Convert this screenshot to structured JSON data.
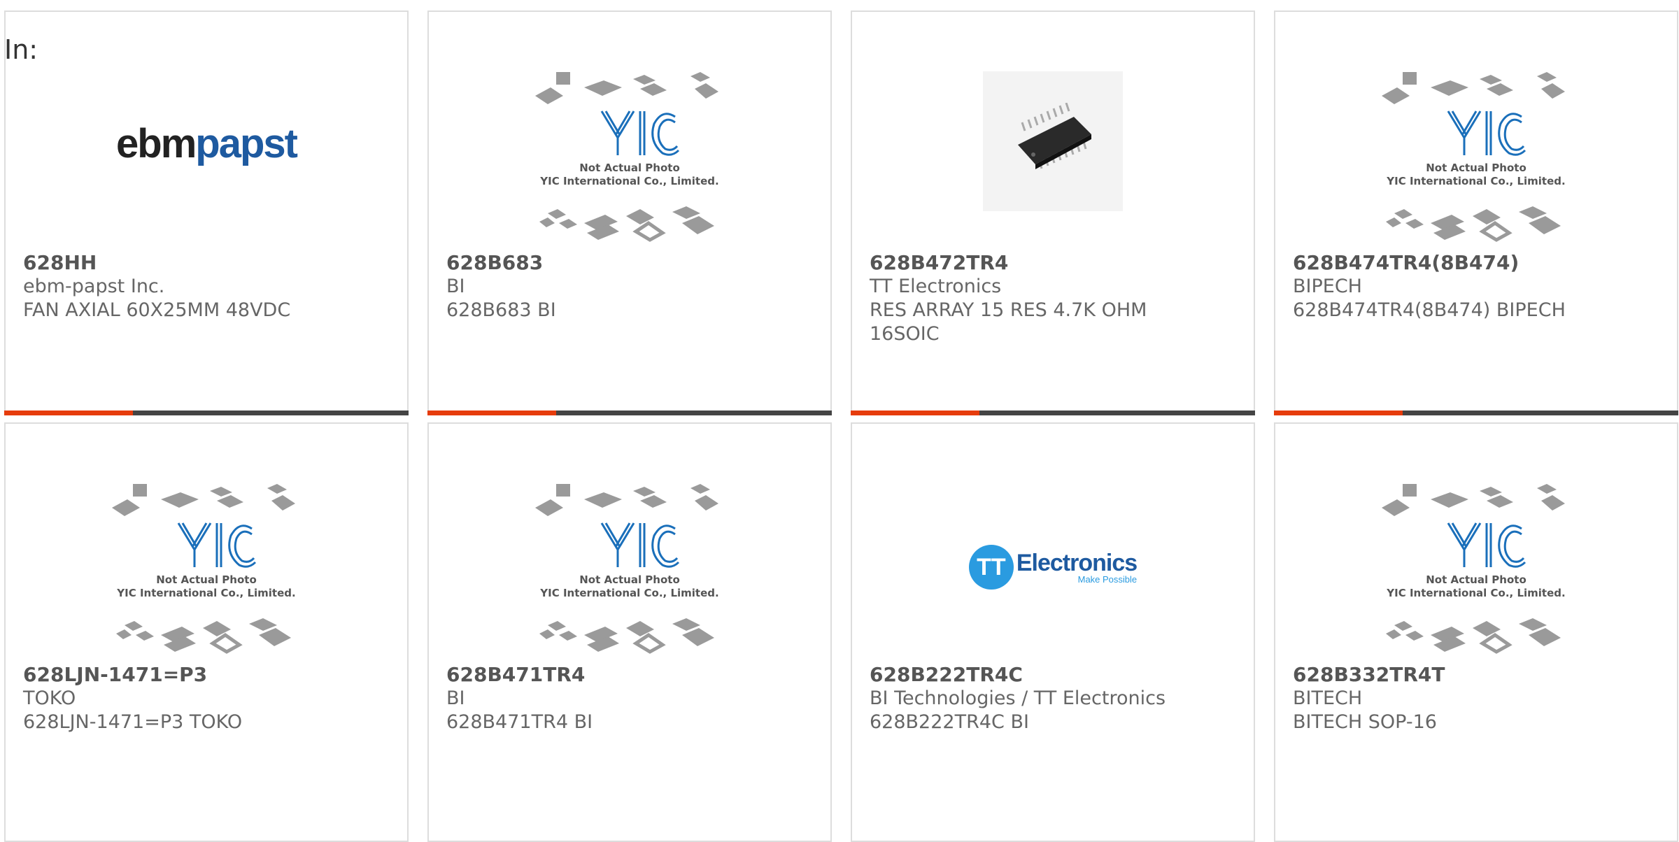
{
  "header": {
    "in_label": "In:"
  },
  "placeholder_image": {
    "line1": "Not Actual Photo",
    "line2": "YIC International Co., Limited.",
    "logo_text": "YIC"
  },
  "logos": {
    "ebmpapst": {
      "part_a": "ebm",
      "part_b": "papst"
    },
    "tt": {
      "circle": "TT",
      "word": "Electronics",
      "tagline": "Make Possible"
    }
  },
  "products": [
    {
      "part_no": "628HH",
      "manufacturer": "ebm-papst Inc.",
      "description": "FAN AXIAL 60X25MM 48VDC",
      "image": "ebmpapst-logo"
    },
    {
      "part_no": "628B683",
      "manufacturer": "BI",
      "description": "628B683 BI",
      "image": "yic-placeholder"
    },
    {
      "part_no": "628B472TR4",
      "manufacturer": "TT Electronics",
      "description": "RES ARRAY 15 RES 4.7K OHM 16SOIC",
      "image": "chip-photo"
    },
    {
      "part_no": "628B474TR4(8B474)",
      "manufacturer": "BIPECH",
      "description": "628B474TR4(8B474) BIPECH",
      "image": "yic-placeholder"
    },
    {
      "part_no": "628LJN-1471=P3",
      "manufacturer": "TOKO",
      "description": "628LJN-1471=P3 TOKO",
      "image": "yic-placeholder"
    },
    {
      "part_no": "628B471TR4",
      "manufacturer": "BI",
      "description": "628B471TR4 BI",
      "image": "yic-placeholder"
    },
    {
      "part_no": "628B222TR4C",
      "manufacturer": "BI Technologies / TT Electronics",
      "description": "628B222TR4C BI",
      "image": "tt-electronics-logo"
    },
    {
      "part_no": "628B332TR4T",
      "manufacturer": "BITECH",
      "description": "BITECH SOP-16",
      "image": "yic-placeholder"
    }
  ],
  "colors": {
    "accent": "#e63c0c",
    "bar": "#444444",
    "border": "#dddddd",
    "text": "#555555"
  }
}
